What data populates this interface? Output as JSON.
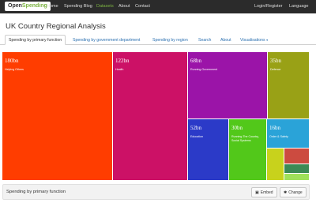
{
  "app": {
    "logo_prefix": "Open",
    "logo_suffix": "Spending",
    "nav": [
      {
        "label": "Home"
      },
      {
        "label": "Spending Blog"
      },
      {
        "label": "Datasets"
      },
      {
        "label": "About"
      },
      {
        "label": "Contact"
      }
    ],
    "nav_right": [
      {
        "label": "Login/Register"
      },
      {
        "label": "Language"
      }
    ]
  },
  "page": {
    "title": "UK Country Regional Analysis",
    "tabs": [
      {
        "label": "Spending by primary function",
        "active": true
      },
      {
        "label": "Spending by government department",
        "active": false
      },
      {
        "label": "Spending by region",
        "active": false
      },
      {
        "label": "Search",
        "active": false
      },
      {
        "label": "About",
        "active": false
      },
      {
        "label": "Visualisations",
        "active": false,
        "caret": "▾"
      }
    ]
  },
  "treemap": {
    "cells": [
      {
        "amount": "180bn",
        "label": "Helping Others",
        "color": "#ff3d00"
      },
      {
        "amount": "122bn",
        "label": "Health",
        "color": "#cc1166"
      },
      {
        "amount": "68bn",
        "label": "Running Government",
        "color": "#9b14a8"
      },
      {
        "amount": "35bn",
        "label": "Defence",
        "color": "#99a116"
      },
      {
        "amount": "52bn",
        "label": "Education",
        "color": "#2b3ac8"
      },
      {
        "amount": "30bn",
        "label": "Running The Country, Social Systems",
        "color": "#52c81a"
      },
      {
        "amount": "16bn",
        "label": "Order & Safety",
        "color": "#2aa3d8"
      },
      {
        "amount": "",
        "label": "",
        "color": "#c8d21c"
      },
      {
        "amount": "",
        "label": "",
        "color": "#cc4b40"
      },
      {
        "amount": "",
        "label": "",
        "color": "#3c8a55"
      },
      {
        "amount": "",
        "label": "",
        "color": "#9fe05a"
      }
    ]
  },
  "footer": {
    "title": "Spending by primary function",
    "embed_label": "Embed",
    "change_label": "Change",
    "embed_icon": "embed-icon",
    "change_icon": "gear-icon"
  }
}
